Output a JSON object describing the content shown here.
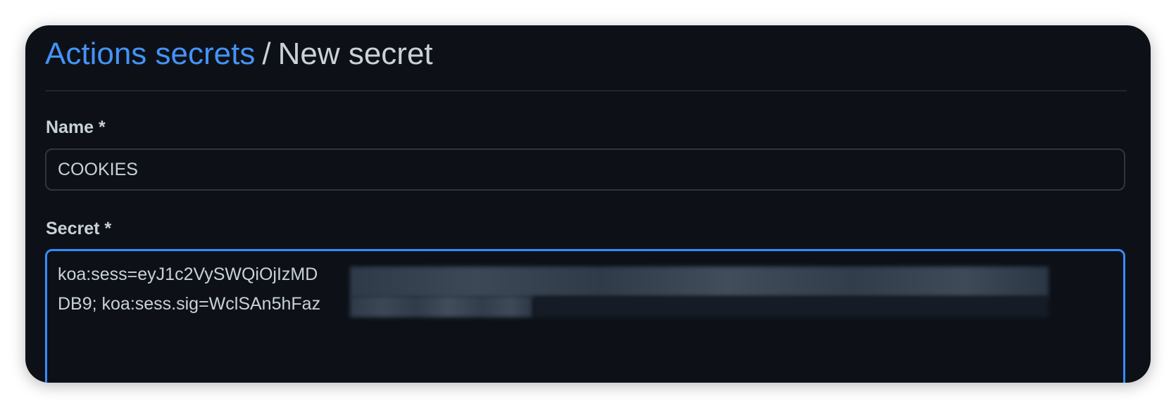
{
  "breadcrumb": {
    "link": "Actions secrets",
    "separator": "/",
    "current": "New secret"
  },
  "form": {
    "name_label": "Name *",
    "name_value": "COOKIES",
    "secret_label": "Secret *",
    "secret_line_1": "koa:sess=eyJ1c2VySWQiOjIzMD",
    "secret_line_2": "DB9; koa:sess.sig=WclSAn5hFaz",
    "redaction_note": ""
  },
  "colors": {
    "background": "#0d1117",
    "link": "#4493f8",
    "text": "#c9d1d9",
    "border": "#30363d",
    "focus_border": "#388bfd"
  }
}
